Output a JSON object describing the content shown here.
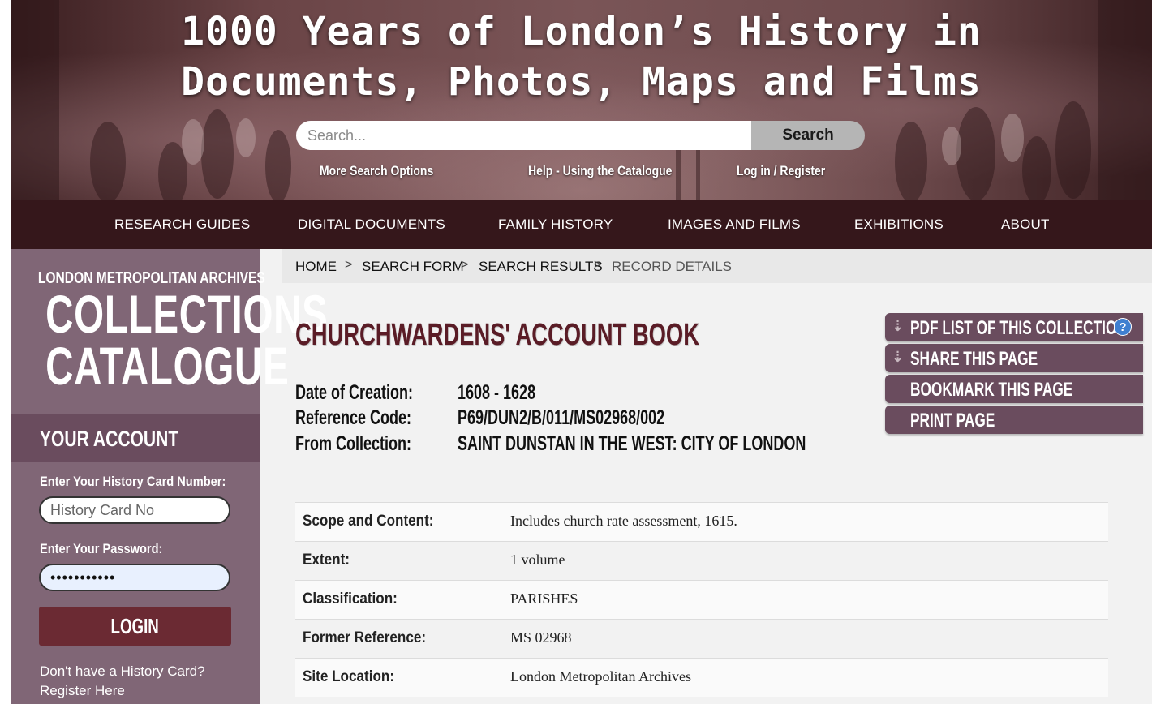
{
  "header": {
    "title_line1": "1000 Years of London’s History in",
    "title_line2": "Documents, Photos, Maps and Films",
    "search_placeholder": "Search...",
    "search_button": "Search",
    "links": [
      "More Search Options",
      "Help - Using the Catalogue",
      "Log in / Register"
    ]
  },
  "nav": {
    "items": [
      "RESEARCH GUIDES",
      "DIGITAL DOCUMENTS",
      "FAMILY HISTORY",
      "IMAGES AND FILMS",
      "EXHIBITIONS",
      "ABOUT"
    ]
  },
  "sidebar": {
    "brand_top": "LONDON METROPOLITAN ARCHIVES",
    "brand_line1": "COLLECTIONS",
    "brand_line2": "CATALOGUE",
    "account_title": "YOUR ACCOUNT",
    "card_label": "Enter Your History Card Number:",
    "card_placeholder": "History Card No",
    "password_label": "Enter Your Password:",
    "password_value": "•••••••••••",
    "login_button": "LOGIN",
    "note_line1": "Don't have a History Card?",
    "note_line2": "Register Here"
  },
  "breadcrumb": {
    "items": [
      "HOME",
      "SEARCH FORM",
      "SEARCH RESULTS",
      "RECORD DETAILS"
    ],
    "separator": ">"
  },
  "record": {
    "title": "CHURCHWARDENS' ACCOUNT BOOK",
    "meta": [
      {
        "label": "Date of Creation:",
        "value": "1608 - 1628"
      },
      {
        "label": "Reference Code:",
        "value": "P69/DUN2/B/011/MS02968/002"
      },
      {
        "label": "From Collection:",
        "value": "SAINT DUNSTAN IN THE WEST: CITY OF LONDON"
      }
    ],
    "details": [
      {
        "label": "Scope and Content:",
        "value": "Includes church rate assessment, 1615."
      },
      {
        "label": "Extent:",
        "value": "1 volume"
      },
      {
        "label": "Classification:",
        "value": "PARISHES"
      },
      {
        "label": "Former Reference:",
        "value": "MS 02968"
      },
      {
        "label": "Site Location:",
        "value": "London Metropolitan Archives"
      }
    ]
  },
  "actions": {
    "pdf_list": "PDF LIST OF THIS COLLECTION",
    "share": "SHARE THIS PAGE",
    "bookmark": "BOOKMARK THIS PAGE",
    "print": "PRINT PAGE",
    "help_glyph": "?",
    "arrow_glyph": "⇣"
  },
  "colors": {
    "nav_bg": "#35171b",
    "sidebar_bg": "#806676",
    "account_bg": "#6a4c5e",
    "title_color": "#5a1c26",
    "login_bg": "#6b2a33"
  }
}
